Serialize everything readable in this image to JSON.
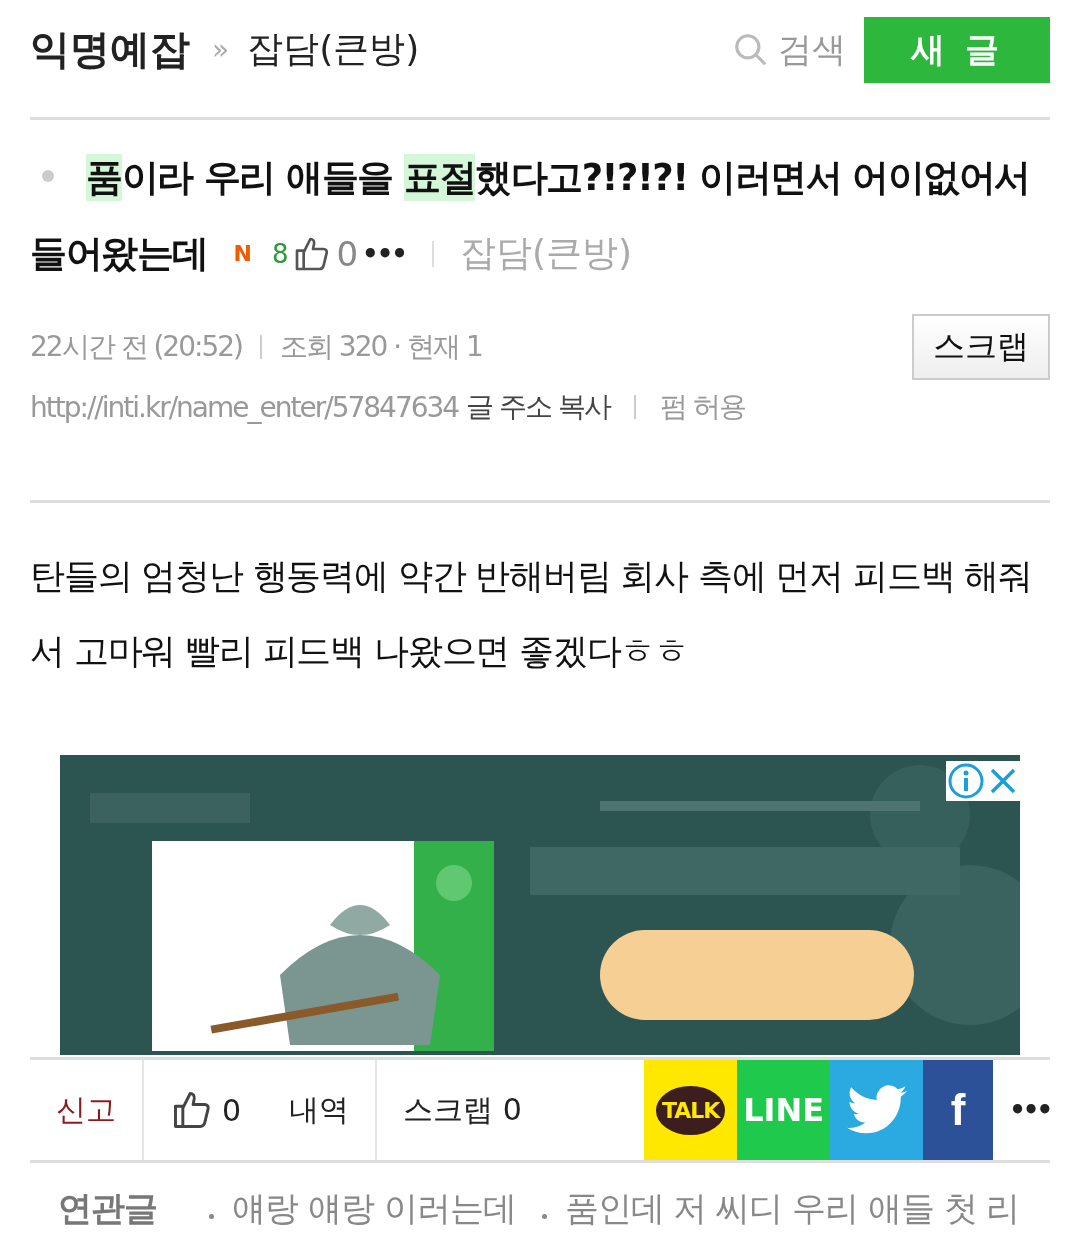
{
  "header": {
    "board": "익명예잡",
    "separator": "»",
    "category": "잡담(큰방)",
    "search_label": "검색",
    "write_button": "새 글"
  },
  "post": {
    "title": [
      {
        "text": "품",
        "highlighted": true
      },
      {
        "text": "이라 우리 애들을 ",
        "highlighted": false
      },
      {
        "text": "표절",
        "highlighted": true
      },
      {
        "text": "했다고?!?!?! 이러면서 어이없어서 들어왔는데",
        "highlighted": false
      }
    ],
    "new_badge": "N",
    "comment_count": "8",
    "likes": "0",
    "more": "•••",
    "category": "잡담(큰방)",
    "time": "22시간 전 (20:52)",
    "views": "조회 320 · 현재 1",
    "scrap_button": "스크랩",
    "url": "http://inti.kr/name_enter/57847634",
    "copy_link": "글 주소 복사",
    "permission": "펌 허용",
    "body": "탄들의 엄청난 행동력에 약간 반해버림 회사 측에 먼저 피드백 해줘서 고마워 빨리 피드백 나왔으면 좋겠다ㅎㅎ"
  },
  "actions": {
    "report": "신고",
    "likes": "0",
    "history": "내역",
    "scrap": "스크랩 0",
    "more": "•••",
    "share": [
      {
        "kind": "kakao",
        "label": "TALK"
      },
      {
        "kind": "line",
        "label": "LINE"
      },
      {
        "kind": "twitter"
      },
      {
        "kind": "facebook",
        "label": "f"
      }
    ]
  },
  "related": {
    "label": "연관글",
    "items": [
      "얘랑 얘랑 이러는데",
      "품인데 저 씨디 우리 애들 첫 리"
    ]
  }
}
